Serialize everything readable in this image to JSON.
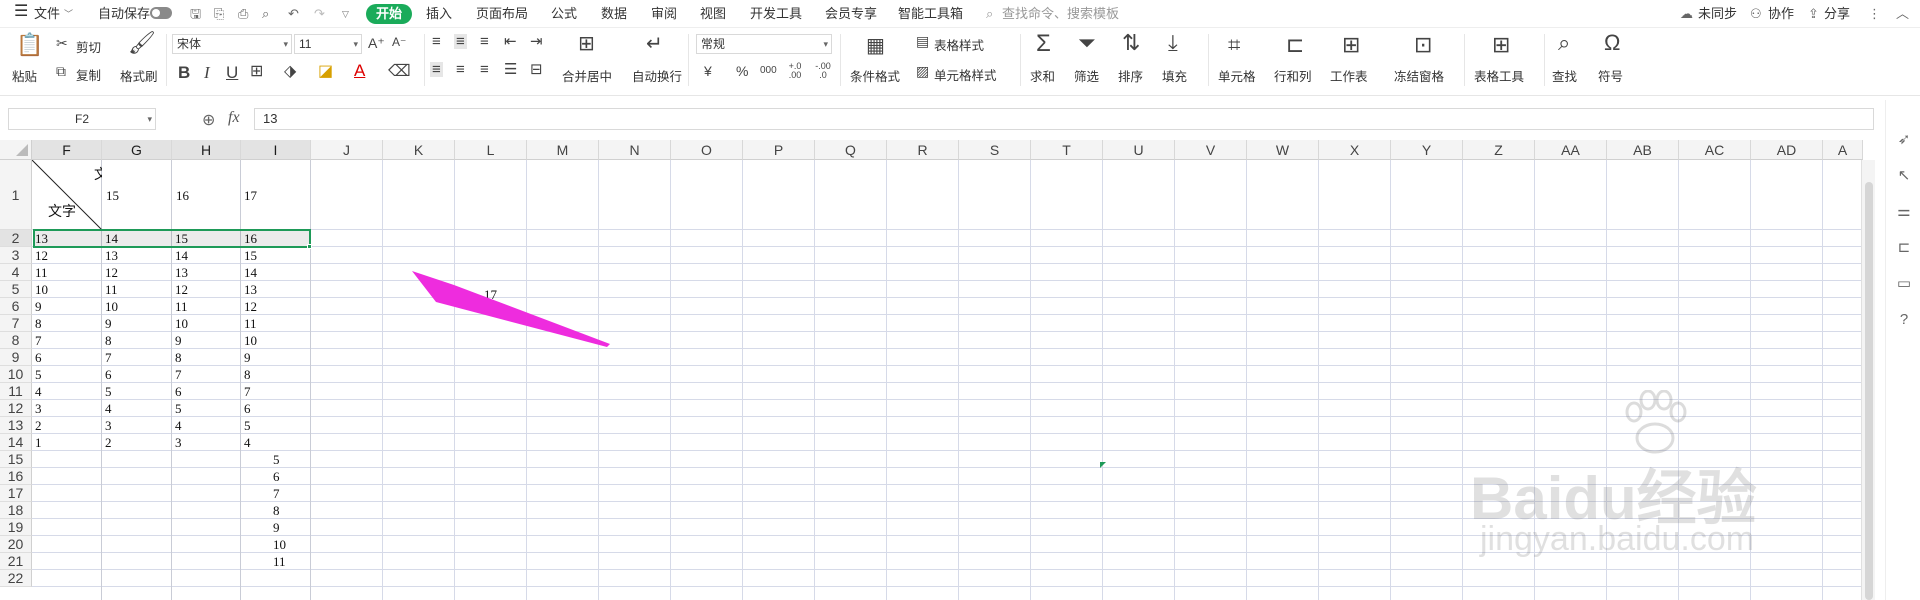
{
  "menu": {
    "file": "文件",
    "autosave": "自动保存",
    "tabs": [
      "开始",
      "插入",
      "页面布局",
      "公式",
      "数据",
      "审阅",
      "视图",
      "开发工具",
      "会员专享",
      "智能工具箱"
    ],
    "search_placeholder": "查找命令、搜索模板",
    "unsync": "未同步",
    "collab": "协作",
    "share": "分享"
  },
  "ribbon": {
    "paste": "粘贴",
    "cut": "剪切",
    "copy": "复制",
    "format_painter": "格式刷",
    "font_name": "宋体",
    "font_size": "11",
    "merge_center": "合并居中",
    "wrap_text": "自动换行",
    "number_format": "常规",
    "conditional_format": "条件格式",
    "table_style": "表格样式",
    "cell_style": "单元格样式",
    "sum": "求和",
    "filter": "筛选",
    "sort": "排序",
    "fill": "填充",
    "cells": "单元格",
    "row_col": "行和列",
    "worksheet": "工作表",
    "freeze": "冻结窗格",
    "table_tools": "表格工具",
    "find": "查找",
    "symbol": "符号",
    "currency": "¥",
    "percent": "%",
    "thousands": "000",
    "dec_inc": "+.0 .00",
    "dec_dec": "-.00 .0"
  },
  "formula_bar": {
    "name_box": "F2",
    "fx": "fx",
    "value": "13"
  },
  "sheet": {
    "columns": [
      "F",
      "G",
      "H",
      "I",
      "J",
      "K",
      "L",
      "M",
      "N",
      "O",
      "P",
      "Q",
      "R",
      "S",
      "T",
      "U",
      "V",
      "W",
      "X",
      "Y",
      "Z",
      "AA",
      "AB",
      "AC",
      "AD",
      "A"
    ],
    "rows": [
      "1",
      "2",
      "3",
      "4",
      "5",
      "6",
      "7",
      "8",
      "9",
      "10",
      "11",
      "12",
      "13",
      "14",
      "15",
      "16",
      "17",
      "18",
      "19",
      "20",
      "21",
      "22"
    ],
    "header_row": {
      "f_top": "文",
      "f_diag": "文字",
      "g": "15",
      "h": "16",
      "i": "17"
    },
    "data_rows": [
      [
        "13",
        "14",
        "15",
        "16"
      ],
      [
        "12",
        "13",
        "14",
        "15"
      ],
      [
        "11",
        "12",
        "13",
        "14"
      ],
      [
        "10",
        "11",
        "12",
        "13"
      ],
      [
        "9",
        "10",
        "11",
        "12"
      ],
      [
        "8",
        "9",
        "10",
        "11"
      ],
      [
        "7",
        "8",
        "9",
        "10"
      ],
      [
        "6",
        "7",
        "8",
        "9"
      ],
      [
        "5",
        "6",
        "7",
        "8"
      ],
      [
        "4",
        "5",
        "6",
        "7"
      ],
      [
        "3",
        "4",
        "5",
        "6"
      ],
      [
        "2",
        "3",
        "4",
        "5"
      ],
      [
        "1",
        "2",
        "3",
        "4"
      ]
    ],
    "lower_i": [
      "5",
      "6",
      "7",
      "8",
      "9",
      "10",
      "11"
    ],
    "l5": "17"
  },
  "watermark": {
    "brand": "Baidu经验",
    "url": "jingyan.baidu.com"
  },
  "colors": {
    "accent": "#1aab5a",
    "arrow": "#ee2cde",
    "selection": "#1e9a58"
  }
}
